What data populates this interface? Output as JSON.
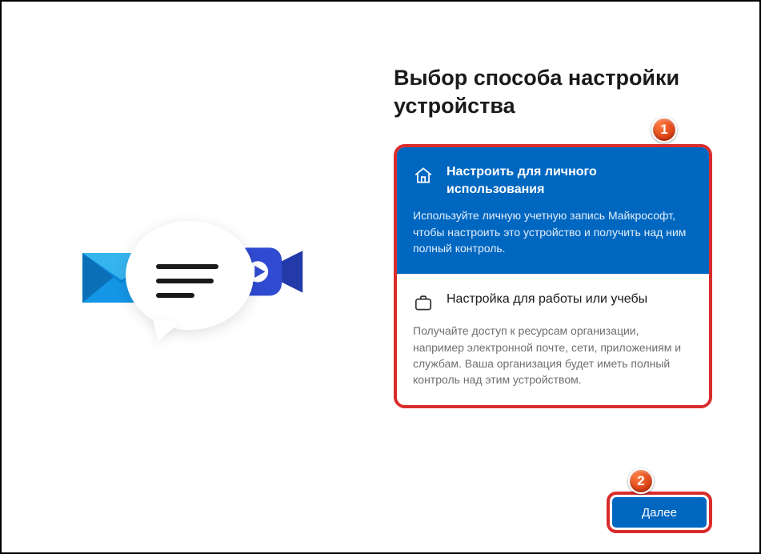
{
  "title": "Выбор способа настройки устройства",
  "options": {
    "personal": {
      "title": "Настроить для личного использования",
      "desc": "Используйте личную учетную запись Майкрософт, чтобы настроить это устройство и получить над ним полный контроль."
    },
    "work": {
      "title": "Настройка для работы или учебы",
      "desc": "Получайте доступ к ресурсам организации, например электронной почте, сети, приложениям и службам. Ваша организация будет иметь полный контроль над этим устройством."
    }
  },
  "buttons": {
    "next": "Далее"
  },
  "badges": {
    "one": "1",
    "two": "2"
  }
}
